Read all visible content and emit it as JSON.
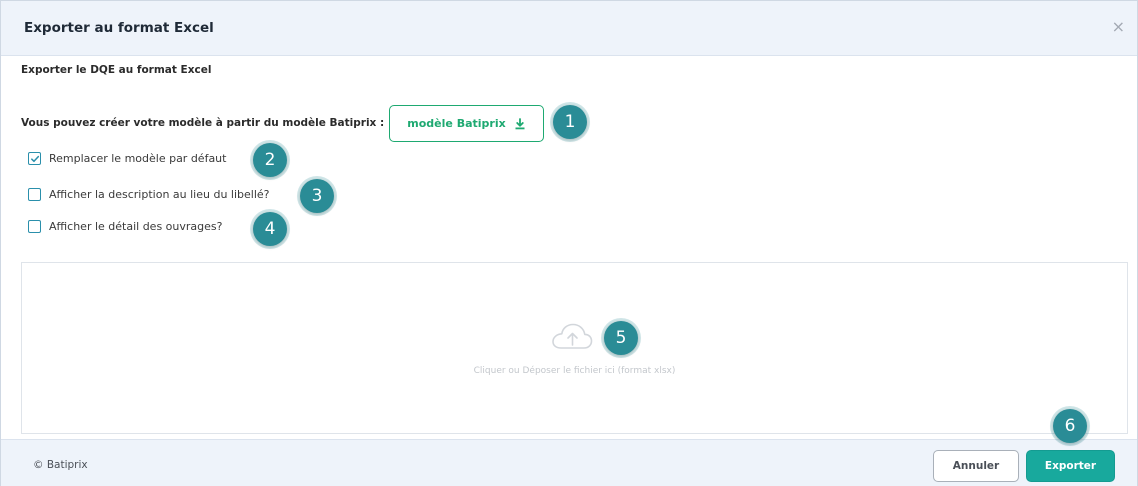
{
  "dialog": {
    "title": "Exporter au format Excel",
    "close_label": "×",
    "subtitle": "Exporter le DQE au format Excel"
  },
  "model_row": {
    "label": "Vous pouvez créer votre modèle à partir du modèle Batiprix :",
    "button_label": "modèle Batiprix",
    "button_icon": "download-icon"
  },
  "options": [
    {
      "label": "Remplacer le modèle par défaut",
      "checked": true
    },
    {
      "label": "Afficher la description au lieu du libellé?",
      "checked": false
    },
    {
      "label": "Afficher le détail des ouvrages?",
      "checked": false
    }
  ],
  "dropzone": {
    "icon": "cloud-upload-icon",
    "text": "Cliquer ou Déposer le fichier ici (format xlsx)"
  },
  "footer": {
    "brand": "© Batiprix",
    "cancel_label": "Annuler",
    "export_label": "Exporter"
  },
  "badges": [
    "1",
    "2",
    "3",
    "4",
    "5",
    "6"
  ],
  "colors": {
    "accent_green": "#1ea971",
    "accent_teal": "#18a99d",
    "checkbox_border": "#2a8fab",
    "badge": "#2a8c96",
    "header_bg": "#eef3fa"
  }
}
